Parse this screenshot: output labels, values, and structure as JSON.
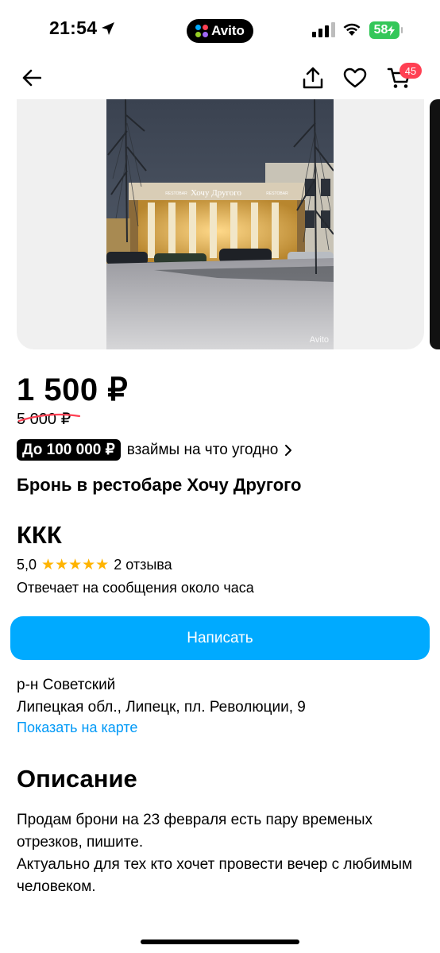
{
  "status_bar": {
    "time": "21:54",
    "app_pill": "Avito",
    "battery": "58"
  },
  "nav": {
    "cart_count": "45"
  },
  "gallery": {
    "watermark": "Avito",
    "sign_main": "Хочу Другого",
    "sign_left": "RESTOBAR",
    "sign_right": "RESTOBAR"
  },
  "listing": {
    "price": "1 500 ₽",
    "old_price": "5 000 ₽",
    "loan_badge": "До 100 000 ₽",
    "loan_text": "взаймы на что угодно",
    "title": "Бронь в рестобаре Хочу Другого"
  },
  "seller": {
    "name": "ККК",
    "rating": "5,0",
    "stars": "★★★★★",
    "reviews": "2 отзыва",
    "reply_time": "Отвечает на сообщения около часа"
  },
  "actions": {
    "write_label": "Написать"
  },
  "location": {
    "district": "р-н Советский",
    "address": "Липецкая обл., Липецк, пл. Революции, 9",
    "map_link": "Показать на карте"
  },
  "description": {
    "heading": "Описание",
    "line1": "Продам брони на 23 февраля есть пару временых отрезков, пишите.",
    "line2": "Актуально для тех кто хочет провести вечер с любимым человеком."
  },
  "colors": {
    "accent": "#00aaff",
    "link": "#0099f7",
    "badge": "#ff4053",
    "star": "#ffb400",
    "battery": "#34c759"
  }
}
